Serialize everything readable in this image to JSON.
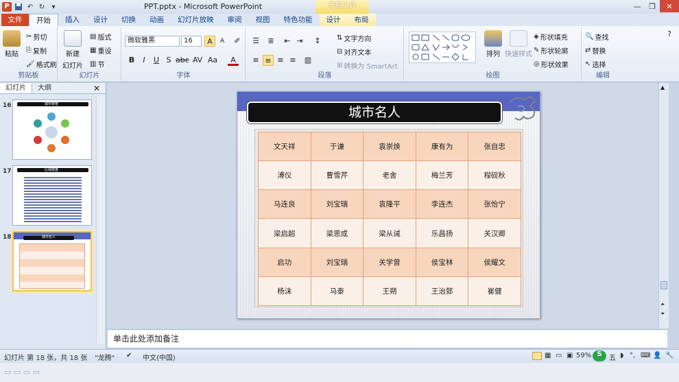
{
  "window": {
    "title": "PPT.pptx - Microsoft PowerPoint",
    "context_title": "表格工具"
  },
  "tabs": [
    "文件",
    "开始",
    "插入",
    "设计",
    "切换",
    "动画",
    "幻灯片放映",
    "审阅",
    "视图",
    "特色功能",
    "设计",
    "布局"
  ],
  "active_tab": "开始",
  "ribbon": {
    "clipboard": {
      "paste": "粘贴",
      "cut": "剪切",
      "copy": "复制",
      "format_painter": "格式刷",
      "label": "剪贴板"
    },
    "slides": {
      "new_slide_line1": "新建",
      "new_slide_line2": "幻灯片",
      "layout": "版式",
      "reset": "重设",
      "section": "节",
      "label": "幻灯片"
    },
    "font": {
      "name": "微软雅黑",
      "size": "16",
      "label": "字体"
    },
    "paragraph": {
      "text_direction": "文字方向",
      "align_text": "对齐文本",
      "smartart": "转换为 SmartArt",
      "label": "段落"
    },
    "drawing": {
      "arrange": "排列",
      "quick_styles": "快速样式",
      "shape_fill": "形状填充",
      "shape_outline": "形状轮廓",
      "shape_effects": "形状效果",
      "label": "绘图"
    },
    "editing": {
      "find": "查找",
      "replace": "替换",
      "select": "选择",
      "label": "编辑"
    }
  },
  "panel": {
    "tab_slides": "幻灯片",
    "tab_outline": "大纲"
  },
  "thumbnails": [
    {
      "number": "16",
      "title": "城市荣誉"
    },
    {
      "number": "17",
      "title": "区域楼盘"
    },
    {
      "number": "18",
      "title": "城市名人"
    }
  ],
  "slide": {
    "title": "城市名人",
    "rows": [
      [
        "文天祥",
        "于谦",
        "袁崇焕",
        "康有为",
        "张自忠"
      ],
      [
        "溥仪",
        "曹雪芹",
        "老舍",
        "梅兰芳",
        "程砚秋"
      ],
      [
        "马连良",
        "刘宝瑞",
        "袁隆平",
        "李连杰",
        "张怡宁"
      ],
      [
        "梁启超",
        "梁思成",
        "梁从诫",
        "乐昌扬",
        "关汉卿"
      ],
      [
        "启功",
        "刘宝瑞",
        "关学曾",
        "侯宝林",
        "侯耀文"
      ],
      [
        "杨沫",
        "马泰",
        "王朔",
        "王治郅",
        "崔健"
      ]
    ]
  },
  "notes_placeholder": "单击此处添加备注",
  "status": {
    "slide_info": "幻灯片 第 18 张，共 18 张",
    "theme": "\"龙腾\"",
    "language": "中文(中国)",
    "zoom": "59%",
    "ime": "五"
  },
  "colors": {
    "file_tab": "#d24726",
    "title_band": "#5666c2",
    "table_odd": "#f8d6bd",
    "table_even": "#fbf0e8",
    "table_border": "#e6a078"
  }
}
